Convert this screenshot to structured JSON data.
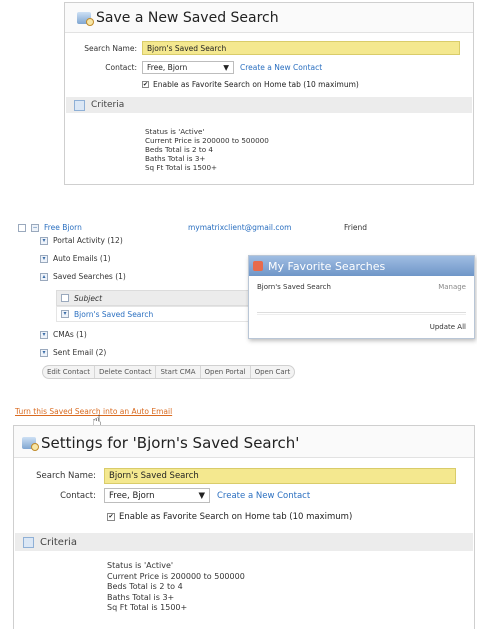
{
  "save_panel": {
    "title": "Save a New Saved Search",
    "search_name_label": "Search Name:",
    "search_name_value": "Bjorn's Saved Search",
    "contact_label": "Contact:",
    "contact_value": "Free, Bjorn",
    "create_contact_link": "Create a New Contact",
    "favorite_checkbox_label": "Enable as Favorite Search on Home tab (10 maximum)",
    "favorite_checked": true,
    "criteria_label": "Criteria",
    "criteria_lines": [
      "Status is 'Active'",
      "Current Price is 200000 to 500000",
      "Beds Total is 2 to 4",
      "Baths Total is 3+",
      "Sq Ft Total is 1500+"
    ]
  },
  "contact_panel": {
    "contact_name": "Free Bjorn",
    "contact_email": "mymatrixclient@gmail.com",
    "contact_type": "Friend",
    "sections": [
      {
        "label": "Portal Activity (12)"
      },
      {
        "label": "Auto Emails (1)"
      },
      {
        "label": "Saved Searches (1)"
      },
      {
        "label": "CMAs (1)"
      },
      {
        "label": "Sent Email (2)"
      }
    ],
    "subject_header": "Subject",
    "saved_search_item": "Bjorn's Saved Search",
    "buttons": [
      "Edit Contact",
      "Delete Contact",
      "Start CMA",
      "Open Portal",
      "Open Cart"
    ]
  },
  "favorites_popup": {
    "title": "My Favorite Searches",
    "item_name": "Bjorn's Saved Search",
    "item_action": "Manage",
    "update_all": "Update All"
  },
  "turn_link": "Turn this Saved Search into an Auto Email",
  "settings_panel": {
    "title": "Settings for 'Bjorn's Saved Search'",
    "search_name_label": "Search Name:",
    "search_name_value": "Bjorn's Saved Search",
    "contact_label": "Contact:",
    "contact_value": "Free, Bjorn",
    "create_contact_link": "Create a New Contact",
    "favorite_checkbox_label": "Enable as Favorite Search on Home tab (10 maximum)",
    "favorite_checked": true,
    "criteria_label": "Criteria",
    "criteria_lines": [
      "Status is 'Active'",
      "Current Price is 200000 to 500000",
      "Beds Total is 2 to 4",
      "Baths Total is 3+",
      "Sq Ft Total is 1500+"
    ]
  },
  "colors": {
    "input_yellow": "#f4e88f",
    "link_blue": "#2a6fc0",
    "link_orange": "#d96a1f",
    "popup_header": "#7fa2cf"
  }
}
